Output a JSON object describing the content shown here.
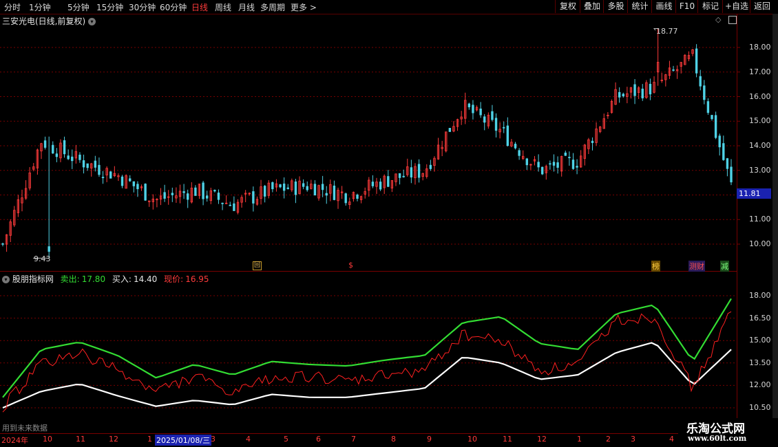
{
  "toolbar": {
    "periods": [
      "分时",
      "1分钟",
      "5分钟",
      "15分钟",
      "30分钟",
      "60分钟",
      "日线",
      "周线",
      "月线",
      "多周期",
      "更多 >"
    ],
    "active_period": "日线",
    "buttons": [
      "复权",
      "叠加",
      "多股",
      "统计",
      "画线",
      "F10",
      "标记",
      "+自选",
      "返回"
    ]
  },
  "main_chart": {
    "title": "三安光电(日线,前复权)",
    "price_axis": [
      "18.00",
      "17.00",
      "16.00",
      "15.00",
      "14.00",
      "13.00",
      "12.00",
      "11.00",
      "10.00"
    ],
    "current_price": "11.81",
    "high_marker": "18.77",
    "low_marker": "9.43",
    "event_markers": [
      "回",
      "$",
      "榜",
      "测财",
      "减"
    ]
  },
  "indicator": {
    "name": "股朋指标网",
    "sell_label": "卖出:",
    "sell_value": "17.80",
    "buy_label": "买入:",
    "buy_value": "14.40",
    "price_label": "现价:",
    "price_value": "16.95",
    "axis": [
      "18.00",
      "16.50",
      "15.00",
      "13.50",
      "12.00",
      "10.50"
    ],
    "footer_text": "用到未来数据"
  },
  "date_axis": {
    "year_label": "2024年",
    "months": [
      "10",
      "11",
      "12",
      "1",
      "2025/01/08/三",
      "3",
      "4",
      "5",
      "6",
      "7",
      "8",
      "9",
      "10",
      "11",
      "12",
      "1",
      "2",
      "3",
      "4"
    ]
  },
  "watermark": {
    "line1": "乐淘公式网",
    "line2": "www.60lt.com"
  },
  "colors": {
    "up": "#ff3b3b",
    "down": "#4fd2e6",
    "sell_line": "#33dd33",
    "buy_line": "#ffffff",
    "price_line": "#ff2020",
    "grid": "#7a0000"
  },
  "chart_data": [
    {
      "type": "candlestick",
      "title": "三安光电(日线,前复权)",
      "ylim": [
        9.0,
        19.2
      ],
      "x": [
        "2024-09",
        "2024-10",
        "2024-11",
        "2024-12",
        "2025-01",
        "2025-02",
        "2025-03",
        "2025-04",
        "2025-05",
        "2025-06",
        "2025-07",
        "2025-08",
        "2025-09",
        "2025-10",
        "2025-11",
        "2025-12",
        "2026-01",
        "2026-02",
        "2026-03",
        "2026-04"
      ],
      "close": [
        10.0,
        14.2,
        13.4,
        12.8,
        11.8,
        12.2,
        11.6,
        12.2,
        12.4,
        12.0,
        12.6,
        13.0,
        15.6,
        14.6,
        13.0,
        13.4,
        16.0,
        16.4,
        17.6,
        12.4
      ],
      "high_point": 18.77,
      "low_point": 9.43
    },
    {
      "type": "line",
      "title": "股朋指标网",
      "ylim": [
        10.2,
        19.0
      ],
      "series": [
        {
          "name": "卖出",
          "values": [
            11.2,
            14.4,
            14.9,
            14.0,
            12.5,
            13.4,
            12.7,
            13.6,
            13.4,
            13.3,
            13.7,
            14.0,
            16.2,
            16.6,
            14.8,
            14.4,
            16.8,
            17.4,
            13.6,
            17.8
          ]
        },
        {
          "name": "买入",
          "values": [
            10.5,
            11.6,
            12.1,
            11.3,
            10.6,
            11.0,
            10.7,
            11.4,
            11.2,
            11.2,
            11.5,
            11.8,
            13.9,
            13.5,
            12.4,
            12.7,
            14.2,
            14.9,
            12.0,
            14.4
          ]
        },
        {
          "name": "现价",
          "values": [
            10.6,
            13.4,
            14.2,
            13.0,
            11.6,
            12.6,
            11.4,
            12.5,
            12.6,
            12.2,
            12.7,
            13.0,
            15.4,
            15.0,
            13.0,
            13.4,
            16.4,
            16.6,
            11.8,
            16.95
          ]
        }
      ]
    }
  ]
}
